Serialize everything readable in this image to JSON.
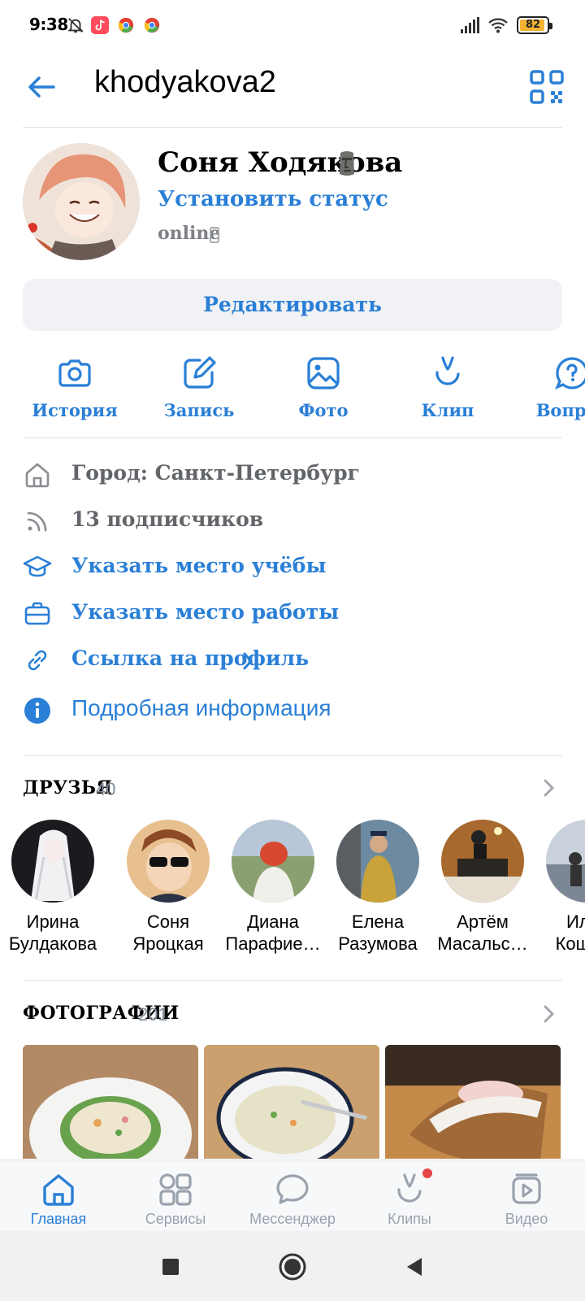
{
  "status_bar": {
    "time": "9:38",
    "battery": "82",
    "icons": [
      "bell-muted-icon",
      "tiktok-icon",
      "chrome-icon",
      "chrome-icon",
      "signal-icon",
      "wifi-icon",
      "battery-icon"
    ]
  },
  "header": {
    "username": "khodyakova2",
    "back_icon": "arrow-left-icon",
    "qr_icon": "qr-code-icon"
  },
  "profile": {
    "name": "Соня Ходякова",
    "status_link": "Установить статус",
    "online": "online",
    "edit_button": "Редактировать"
  },
  "actions": [
    {
      "label": "История",
      "icon": "camera-icon"
    },
    {
      "label": "Запись",
      "icon": "edit-square-icon"
    },
    {
      "label": "Фото",
      "icon": "image-icon"
    },
    {
      "label": "Клип",
      "icon": "clips-icon"
    },
    {
      "label": "Вопрос",
      "icon": "question-bubble-icon"
    }
  ],
  "info": {
    "city": "Город: Санкт-Петербург",
    "followers": "13 подписчиков",
    "education": "Указать место учёбы",
    "work": "Указать место работы",
    "profile_link": "Ссылка на профиль",
    "details": "Подробная информация"
  },
  "friends": {
    "title": "ДРУЗЬЯ",
    "count": "40",
    "items": [
      {
        "first": "Ирина",
        "last": "Булдакова"
      },
      {
        "first": "Соня",
        "last": "Яроцкая"
      },
      {
        "first": "Диана",
        "last": "Парафие…"
      },
      {
        "first": "Елена",
        "last": "Разумова"
      },
      {
        "first": "Артём",
        "last": "Масальс…"
      },
      {
        "first": "Илья",
        "last": "Кошаев"
      }
    ]
  },
  "photos": {
    "title": "ФОТОГРАФИИ",
    "count": "201"
  },
  "tabbar": [
    {
      "label": "Главная",
      "icon": "home-icon",
      "active": true
    },
    {
      "label": "Сервисы",
      "icon": "services-grid-icon",
      "active": false
    },
    {
      "label": "Мессенджер",
      "icon": "chat-bubble-icon",
      "active": false
    },
    {
      "label": "Клипы",
      "icon": "clips-icon",
      "active": false,
      "badge": true
    },
    {
      "label": "Видео",
      "icon": "video-icon",
      "active": false
    }
  ],
  "colors": {
    "accent": "#2a7fd6",
    "secondary_text": "#818c99",
    "badge": "#e64646"
  }
}
